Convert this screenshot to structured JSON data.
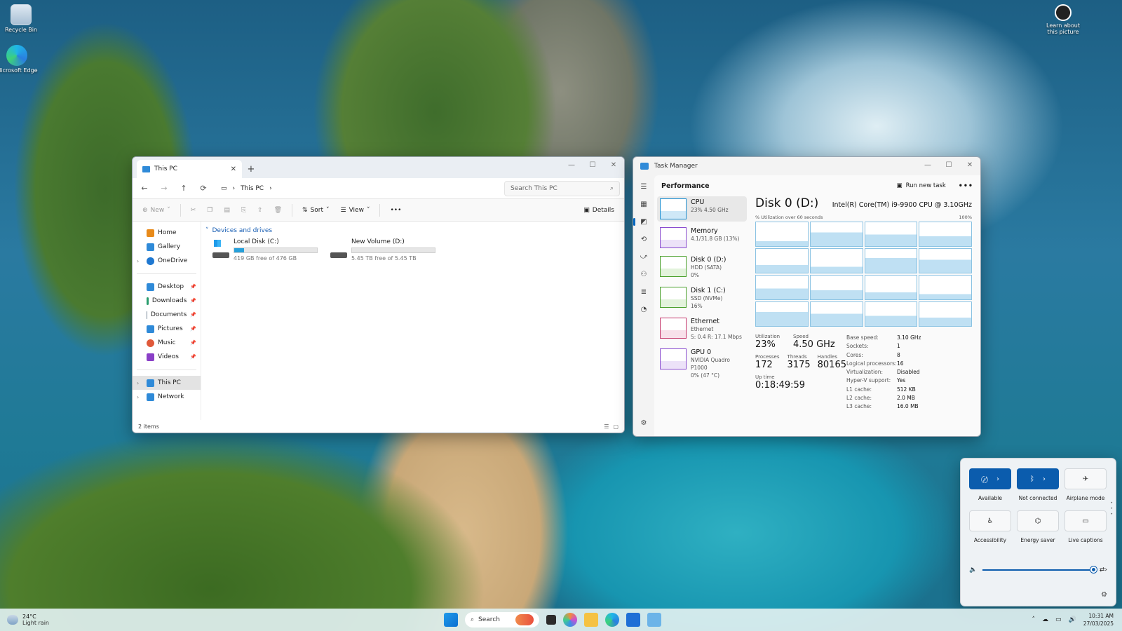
{
  "desktop": {
    "icons": [
      {
        "label": "Recycle Bin",
        "name": "recycle-bin-icon"
      },
      {
        "label": "Microsoft Edge",
        "name": "edge-icon"
      }
    ],
    "learn_label": "Learn about this picture"
  },
  "explorer": {
    "tab_title": "This PC",
    "breadcrumb": "This PC",
    "search_placeholder": "Search This PC",
    "commands": {
      "new": "New",
      "sort": "Sort",
      "view": "View",
      "details": "Details"
    },
    "nav": {
      "top": [
        "Home",
        "Gallery",
        "OneDrive"
      ],
      "quick": [
        "Desktop",
        "Downloads",
        "Documents",
        "Pictures",
        "Music",
        "Videos"
      ],
      "bottom": [
        "This PC",
        "Network"
      ]
    },
    "group_header": "Devices and drives",
    "drives": [
      {
        "name": "Local Disk (C:)",
        "free": "419 GB free of 476 GB",
        "used_fraction": 0.12
      },
      {
        "name": "New Volume (D:)",
        "free": "5.45 TB free of 5.45 TB",
        "used_fraction": 0.0
      }
    ],
    "status": "2 items"
  },
  "taskmanager": {
    "title": "Task Manager",
    "section": "Performance",
    "run_new_task": "Run new task",
    "devices": [
      {
        "name": "CPU",
        "sub1": "23% 4.50 GHz",
        "sub2": "",
        "sub3": ""
      },
      {
        "name": "Memory",
        "sub1": "4.1/31.8 GB (13%)",
        "sub2": "",
        "sub3": ""
      },
      {
        "name": "Disk 0 (D:)",
        "sub1": "HDD (SATA)",
        "sub2": "0%",
        "sub3": ""
      },
      {
        "name": "Disk 1 (C:)",
        "sub1": "SSD (NVMe)",
        "sub2": "16%",
        "sub3": ""
      },
      {
        "name": "Ethernet",
        "sub1": "Ethernet",
        "sub2": "S: 0.4  R: 17.1 Mbps",
        "sub3": ""
      },
      {
        "name": "GPU 0",
        "sub1": "NVIDIA Quadro P1000",
        "sub2": "0% (47 °C)",
        "sub3": ""
      }
    ],
    "detail": {
      "title": "Disk 0 (D:)",
      "cpu_model": "Intel(R) Core(TM) i9-9900 CPU @ 3.10GHz",
      "graph_caption": "% Utilization over 60 seconds",
      "graph_max": "100%",
      "stats": {
        "utilization_label": "Utilization",
        "utilization": "23%",
        "speed_label": "Speed",
        "speed": "4.50 GHz",
        "processes_label": "Processes",
        "processes": "172",
        "threads_label": "Threads",
        "threads": "3175",
        "handles_label": "Handles",
        "handles": "80165",
        "uptime_label": "Up time",
        "uptime": "0:18:49:59"
      },
      "specs": [
        {
          "k": "Base speed:",
          "v": "3.10 GHz"
        },
        {
          "k": "Sockets:",
          "v": "1"
        },
        {
          "k": "Cores:",
          "v": "8"
        },
        {
          "k": "Logical processors:",
          "v": "16"
        },
        {
          "k": "Virtualization:",
          "v": "Disabled"
        },
        {
          "k": "Hyper-V support:",
          "v": "Yes"
        },
        {
          "k": "L1 cache:",
          "v": "512 KB"
        },
        {
          "k": "L2 cache:",
          "v": "2.0 MB"
        },
        {
          "k": "L3 cache:",
          "v": "16.0 MB"
        }
      ]
    }
  },
  "quick_settings": {
    "tiles": [
      {
        "label": "Available",
        "icon": "wifi-icon",
        "on": true
      },
      {
        "label": "Not connected",
        "icon": "bluetooth-icon",
        "on": true
      },
      {
        "label": "Airplane mode",
        "icon": "airplane-icon",
        "on": false
      },
      {
        "label": "Accessibility",
        "icon": "accessibility-icon",
        "on": false
      },
      {
        "label": "Energy saver",
        "icon": "energy-saver-icon",
        "on": false
      },
      {
        "label": "Live captions",
        "icon": "live-captions-icon",
        "on": false
      }
    ],
    "volume_level": 1.0
  },
  "taskbar": {
    "weather_temp": "24°C",
    "weather_desc": "Light rain",
    "search_label": "Search",
    "time": "10:31 AM",
    "date": "27/03/2025"
  }
}
